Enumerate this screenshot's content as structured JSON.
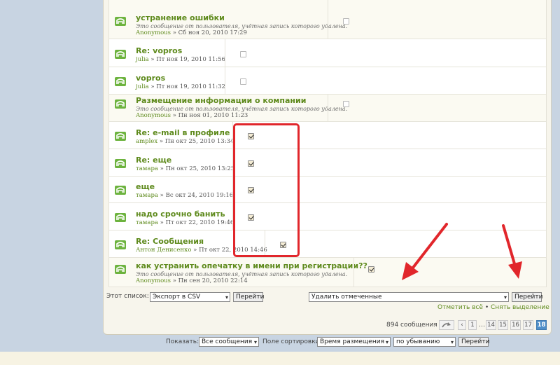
{
  "topics": [
    {
      "title": "устранение ошибки",
      "note": "Это сообщение от пользователя, учётная запись которого удалена.",
      "author": "Anonymous",
      "date": "Сб ноя 20, 2010 17:29",
      "checked": false
    },
    {
      "title": "Re: vopros",
      "note": "",
      "author": "julia",
      "date": "Пт ноя 19, 2010 11:56",
      "checked": false
    },
    {
      "title": "vopros",
      "note": "",
      "author": "julia",
      "date": "Пт ноя 19, 2010 11:32",
      "checked": false
    },
    {
      "title": "Размещение информации о компании",
      "note": "Это сообщение от пользователя, учётная запись которого удалена.",
      "author": "Anonymous",
      "date": "Пн ноя 01, 2010 11:23",
      "checked": false
    },
    {
      "title": "Re: e-mail в профиле",
      "note": "",
      "author": "amplex",
      "date": "Пн окт 25, 2010 13:34",
      "checked": true
    },
    {
      "title": "Re: еще",
      "note": "",
      "author": "тамара",
      "date": "Пн окт 25, 2010 13:25",
      "checked": true
    },
    {
      "title": "еще",
      "note": "",
      "author": "тамара",
      "date": "Вс окт 24, 2010 19:16",
      "checked": true
    },
    {
      "title": "надо срочно банить",
      "note": "",
      "author": "тамара",
      "date": "Пт окт 22, 2010 19:46",
      "checked": true
    },
    {
      "title": "Re: Сообщения",
      "note": "",
      "author": "Антон Денисенко",
      "date": "Пт окт 22, 2010 14:46",
      "checked": true
    },
    {
      "title": "как устранить опечатку в имени при регистрации??",
      "note": "Это сообщение от пользователя, учётная запись которого удалена.",
      "author": "Anonymous",
      "date": "Пн сен 20, 2010 22:14",
      "checked": true
    }
  ],
  "meta_separator": " » ",
  "list_actions": {
    "label": "Этот список:",
    "export_value": "Экспорт в CSV",
    "go_label": "Перейти",
    "action_value": "Удалить отмеченные",
    "action_go_label": "Перейти",
    "mark_all": "Отметить всё",
    "bullet": "•",
    "unmark": "Снять выделение"
  },
  "pagination": {
    "count_text": "894 сообщения",
    "ellipsis": "…",
    "pages": [
      "1",
      "14",
      "15",
      "16",
      "17",
      "18"
    ],
    "current": "18"
  },
  "footer": {
    "show_label": "Показать:",
    "show_value": "Все сообщения",
    "sort_label": "Поле сортировки",
    "sort_value": "Время размещения",
    "order_value": "по убыванию",
    "go_label": "Перейти"
  },
  "colors": {
    "accent_green": "#5e8a1c",
    "highlight_red": "#e1262b",
    "active_page": "#4f8fc9"
  }
}
